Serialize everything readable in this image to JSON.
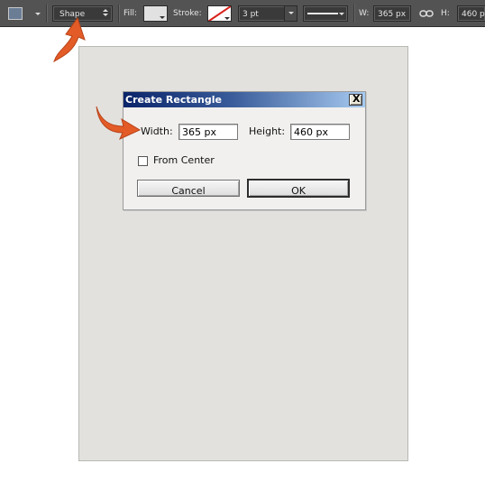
{
  "options_bar": {
    "tool_icon": "rectangle-tool-icon",
    "mode_value": "Shape",
    "fill_label": "Fill:",
    "stroke_label": "Stroke:",
    "stroke_width_value": "3 pt",
    "w_label": "W:",
    "w_value": "365 px",
    "link_icon": "link-icon",
    "h_label": "H:",
    "h_value": "460 px"
  },
  "dialog": {
    "title": "Create Rectangle",
    "close_label": "X",
    "width_label": "Width:",
    "width_value": "365 px",
    "height_label": "Height:",
    "height_value": "460 px",
    "from_center_label": "From Center",
    "from_center_checked": false,
    "cancel_label": "Cancel",
    "ok_label": "OK"
  },
  "colors": {
    "options_bar_bg": "#535353",
    "canvas_bg": "#e2e1de",
    "fill_swatch": "#e1e1e1",
    "stroke_no_color_slash": "#d8201a",
    "annotation_arrow": "#e35b26"
  }
}
